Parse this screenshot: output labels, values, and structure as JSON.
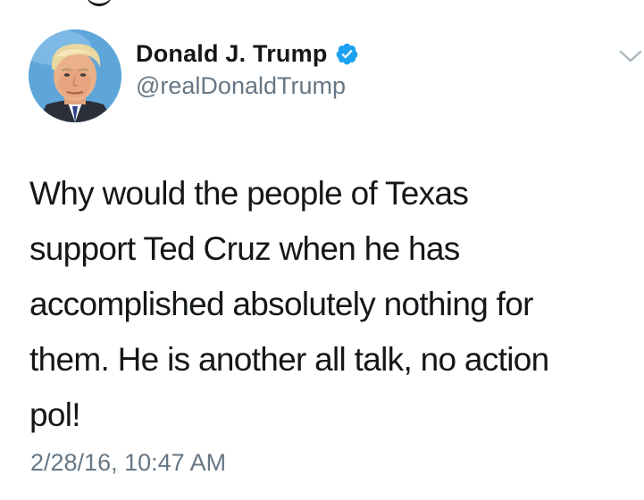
{
  "tweet": {
    "author": {
      "display_name": "Donald J. Trump",
      "handle": "@realDonaldTrump",
      "verified": true,
      "verified_icon": "verified-badge-icon",
      "avatar": "profile-avatar"
    },
    "text": "Why would the people of Texas\nsupport Ted Cruz when he has\naccomplished absolutely nothing for\nthem. He is another all talk, no action\npol!",
    "timestamp": "2/28/16, 10:47 AM",
    "menu_icon": "chevron-down-icon"
  },
  "colors": {
    "text_primary": "#14171a",
    "text_secondary": "#657786",
    "verified_blue": "#1da1f2",
    "chevron": "#aab8c2",
    "background": "#ffffff"
  }
}
